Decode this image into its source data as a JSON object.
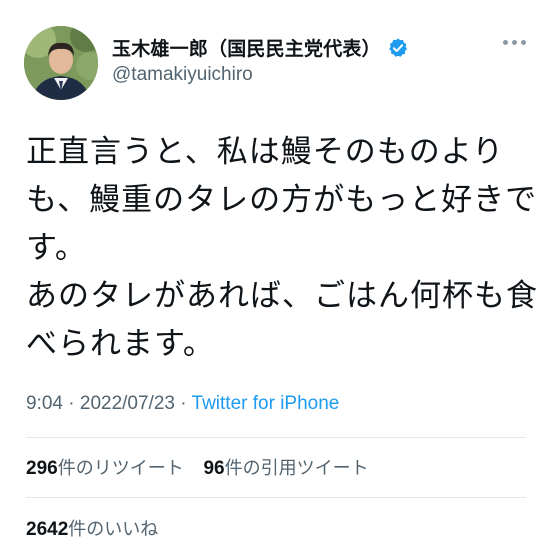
{
  "author": {
    "display_name": "玉木雄一郎（国民民主党代表）",
    "handle": "@tamakiyuichiro",
    "verified_icon": "verified-badge-icon",
    "avatar_icon": "profile-photo"
  },
  "tweet": {
    "lines": [
      "正直言うと、私は鰻そのものより",
      "も、鰻重のタレの方がもっと好きで",
      "す。",
      "あのタレがあれば、ごはん何杯も食",
      "べられます。"
    ]
  },
  "meta": {
    "time": "9:04",
    "separator": "·",
    "date": "2022/07/23",
    "source": "Twitter for iPhone"
  },
  "stats": {
    "retweets_count": "296",
    "retweets_label": "件のリツイート",
    "quotes_count": "96",
    "quotes_label": "件の引用ツイート",
    "likes_count": "2642",
    "likes_label": "件のいいね"
  },
  "colors": {
    "link": "#1d9bf0",
    "secondary": "#536471",
    "verified": "#1d9bf0"
  }
}
